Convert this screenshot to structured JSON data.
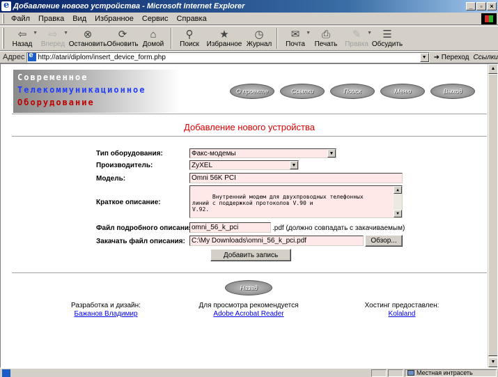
{
  "window": {
    "title": "Добавление нового устройства - Microsoft Internet Explorer",
    "buttons": [
      "_",
      "▫",
      "×"
    ]
  },
  "menu": [
    "Файл",
    "Правка",
    "Вид",
    "Избранное",
    "Сервис",
    "Справка"
  ],
  "toolbar": [
    {
      "label": "Назад",
      "icon": "back-arrow-icon",
      "glyph": "⇦",
      "enabled": true
    },
    {
      "label": "Вперед",
      "icon": "forward-arrow-icon",
      "glyph": "⇨",
      "enabled": false
    },
    {
      "label": "Остановить",
      "icon": "stop-icon",
      "glyph": "⊗",
      "enabled": true
    },
    {
      "label": "Обновить",
      "icon": "refresh-icon",
      "glyph": "⟳",
      "enabled": true
    },
    {
      "label": "Домой",
      "icon": "home-icon",
      "glyph": "⌂",
      "enabled": true
    },
    {
      "label": "Поиск",
      "icon": "search-icon",
      "glyph": "⚲",
      "enabled": true
    },
    {
      "label": "Избранное",
      "icon": "favorites-icon",
      "glyph": "★",
      "enabled": true
    },
    {
      "label": "Журнал",
      "icon": "history-icon",
      "glyph": "◷",
      "enabled": true
    },
    {
      "label": "Почта",
      "icon": "mail-icon",
      "glyph": "✉",
      "enabled": true
    },
    {
      "label": "Печать",
      "icon": "print-icon",
      "glyph": "⎙",
      "enabled": true
    },
    {
      "label": "Правка",
      "icon": "edit-icon",
      "glyph": "✎",
      "enabled": false
    },
    {
      "label": "Обсудить",
      "icon": "discuss-icon",
      "glyph": "☰",
      "enabled": true
    }
  ],
  "address": {
    "label": "Адрес",
    "url": "http://atari/diplom/insert_device_form.php",
    "go": "Переход",
    "links": "Ссылки"
  },
  "header": {
    "logo_lines": [
      "Современное",
      "Телекоммуникационное",
      "Оборудование"
    ],
    "nav": [
      "О проекте",
      "Ссылки",
      "Поиск",
      "Меню",
      "Выход"
    ]
  },
  "page_title": "Добавление нового устройства",
  "form": {
    "type_label": "Тип оборудования:",
    "type_value": "Факс-модемы",
    "maker_label": "Производитель:",
    "maker_value": "ZyXEL",
    "model_label": "Модель:",
    "model_value": "Omni 56K PCI",
    "desc_label": "Краткое описание:",
    "desc_value": "Внутренний модем для двухпроводных телефонных\nлиний с поддержкой протоколов V.90 и\nV.92.",
    "file_label": "Файл подробного описания:",
    "file_value": "omni_56_k_pci",
    "file_hint": ".pdf (должно совпадать с закачиваемым)",
    "upload_label": "Закачать файл описания:",
    "upload_value": "C:\\My Downloads\\omni_56_k_pci.pdf",
    "browse_label": "Обзор...",
    "submit_label": "Добавить запись"
  },
  "back_label": "Назад",
  "footer": {
    "dev_text": "Разработка и дизайн:",
    "dev_link": "Бажанов Владимир",
    "view_text": "Для просмотра рекомендуется",
    "view_link": "Adobe Acrobat Reader",
    "host_text": "Хостинг предоставлен:",
    "host_link": "Kolaland"
  },
  "status": {
    "zone": "Местная интрасеть"
  }
}
